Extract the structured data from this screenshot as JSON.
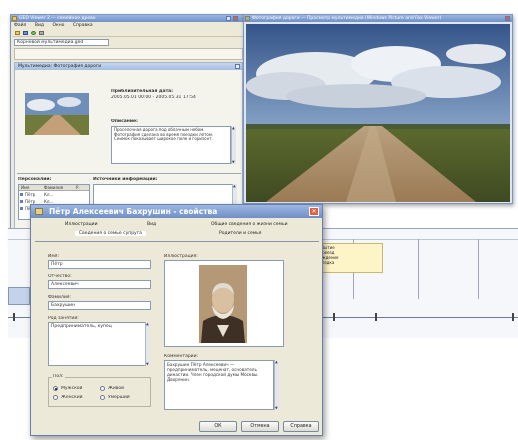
{
  "left_window": {
    "title": "GED Viewer 2 — семейное древо",
    "menu": [
      "Файл",
      "Вид",
      "Окно",
      "Справка"
    ],
    "path_bar": "Корневой мультимедиа.ged",
    "panel_title": "Мультимедиа: Фотография дороги",
    "date_label": "Приблизительная дата:",
    "date_value": "2005.05.01 00:00 - 2005.05.31 17:54",
    "desc_label": "Описание:",
    "desc_value": "Проселочная дорога под облачным небом. Фотография сделана во время поездки летом. Снимок показывает широкое поле и горизонт.",
    "persons_label": "Персоналии:",
    "related_label": "Источники информации:",
    "persons_headers": [
      "Имя",
      "Фамилия",
      "Р."
    ],
    "persons_rows": [
      {
        "name": "Пётр",
        "surname": "Кл..."
      },
      {
        "name": "Пётр",
        "surname": "Кл..."
      },
      {
        "name": "Пётр",
        "surname": "Кл..."
      }
    ]
  },
  "right_window": {
    "title": "Фотография дороги — Просмотр мультимедиа (Windows Picture and Fax Viewer)"
  },
  "timeline": {
    "event_text": "событие\nпереезд\nрождение\nпоездка"
  },
  "dialog": {
    "title": "Пётр Алексеевич Бахрушин - свойства",
    "tabs_row1": [
      "Иллюстрации",
      "Вид",
      "Общие сведения о жизни семьи"
    ],
    "tabs_row2": [
      "Сведения о семье супруга",
      "Родители и семья"
    ],
    "name_label": "Имя:",
    "name_value": "Пётр",
    "patronymic_label": "Отчество:",
    "patronymic_value": "Алексеевич",
    "surname_label": "Фамилия:",
    "surname_value": "Бахрушин",
    "occupation_label": "Род занятий:",
    "occupation_value": "Предприниматель, купец",
    "gender_label": "Пол:",
    "gender_options": [
      "Мужской",
      "Женский"
    ],
    "status_options": [
      "Живой",
      "Умерший"
    ],
    "selected_gender": "Мужской",
    "photo_label": "Иллюстрация:",
    "comments_label": "Комментарии:",
    "comments_value": "Бахрушин Пётр Алексеевич — предприниматель, меценат, основатель династии. Член городской думы Москвы. Дворянин.",
    "ok_label": "ОК",
    "cancel_label": "Отмена",
    "help_label": "Справка"
  },
  "colors": {
    "titlebar": "#7091c8",
    "window_bg": "#ece9d8",
    "close": "#e06040",
    "timeline_highlight": "#fdf5c8"
  }
}
